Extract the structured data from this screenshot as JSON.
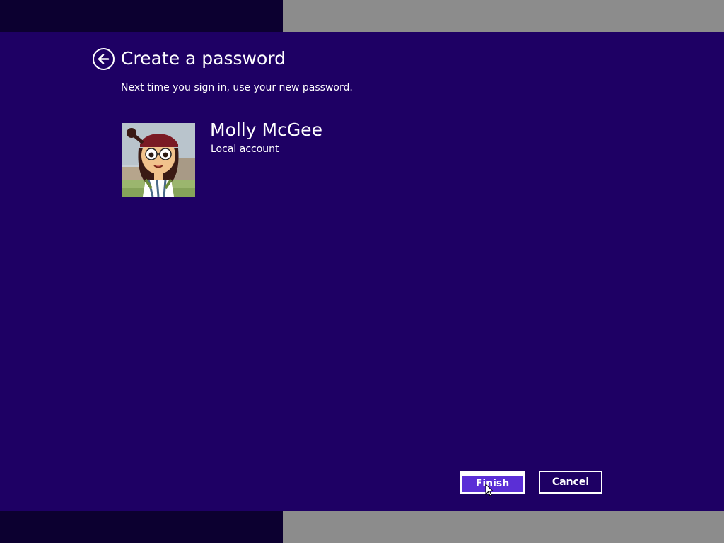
{
  "dialog": {
    "title": "Create a password",
    "subtitle": "Next time you sign in, use your new password."
  },
  "account": {
    "name": "Molly McGee",
    "type": "Local account"
  },
  "buttons": {
    "finish_label": "Finish",
    "cancel_label": "Cancel"
  },
  "icons": {
    "back": "back-arrow-icon",
    "avatar": "user-avatar-image",
    "cursor": "mouse-pointer-icon"
  },
  "colors": {
    "background": "#1e0064",
    "accent": "#5b2fd6",
    "text": "#ffffff",
    "chrome_dark": "#0c0030",
    "chrome_grey": "#8c8c8c"
  }
}
